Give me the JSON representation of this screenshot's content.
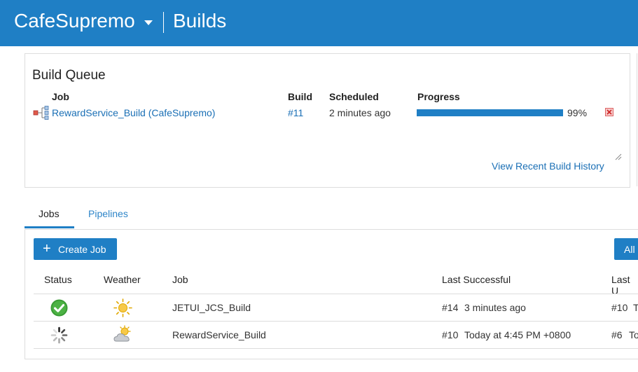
{
  "header": {
    "project": "CafeSupremo",
    "page": "Builds"
  },
  "queue": {
    "title": "Build Queue",
    "columns": {
      "job": "Job",
      "build": "Build",
      "scheduled": "Scheduled",
      "progress": "Progress"
    },
    "item": {
      "job_name": "RewardService_Build",
      "job_context": "(CafeSupremo)",
      "build": "#11",
      "scheduled": "2 minutes ago",
      "progress_label": "99%",
      "progress_value": 0.99
    },
    "history_link": "View Recent Build History"
  },
  "tabs": [
    {
      "label": "Jobs",
      "active": true
    },
    {
      "label": "Pipelines",
      "active": false
    }
  ],
  "toolbar": {
    "create_label": "Create Job",
    "all_label": "All"
  },
  "jobs_table": {
    "headers": {
      "status": "Status",
      "weather": "Weather",
      "job": "Job",
      "last_successful": "Last Successful",
      "last_unsuccessful": "Last U"
    },
    "rows": [
      {
        "status_icon": "success-check-icon",
        "weather_icon": "sunny-icon",
        "job": "JETUI_JCS_Build",
        "last_success_build": "#14",
        "last_success_time": "3 minutes ago",
        "last_fail_build": "#10",
        "last_fail_time": "T"
      },
      {
        "status_icon": "running-spinner-icon",
        "weather_icon": "partly-cloudy-icon",
        "job": "RewardService_Build",
        "last_success_build": "#10",
        "last_success_time": "Today at 4:45 PM +0800",
        "last_fail_build": "#6",
        "last_fail_time": "To"
      }
    ]
  },
  "colors": {
    "brand": "#1f7fc5",
    "link": "#1a6fb5",
    "success": "#3a9c35"
  }
}
